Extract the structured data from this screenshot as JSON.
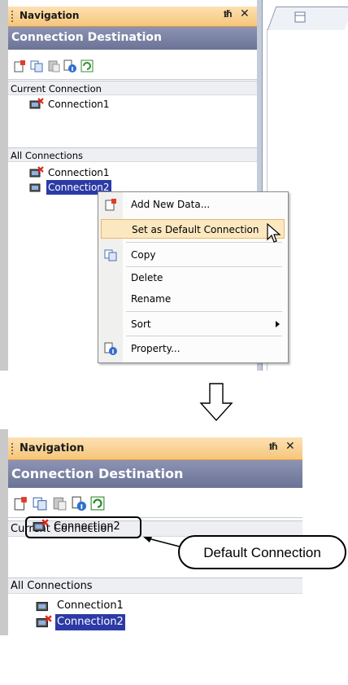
{
  "top_panel": {
    "nav_title": "Navigation",
    "pin": "X",
    "dest_title": "Connection Destination",
    "current_label": "Current Connection",
    "current_connection": "Connection1",
    "all_label": "All Connections",
    "all_connections": [
      "Connection1",
      "Connection2"
    ]
  },
  "context_menu": {
    "items": [
      {
        "label": "Add New Data..."
      },
      {
        "label": "Set as Default Connection"
      },
      {
        "label": "Copy"
      },
      {
        "label": "Delete"
      },
      {
        "label": "Rename"
      },
      {
        "label": "Sort"
      },
      {
        "label": "Property..."
      }
    ]
  },
  "bottom_panel": {
    "nav_title": "Navigation",
    "dest_title": "Connection Destination",
    "current_label": "Current Connection",
    "current_connection": "Connection2",
    "all_label": "All Connections",
    "all_connections": [
      "Connection1",
      "Connection2"
    ]
  },
  "callout": {
    "text": "Default Connection"
  },
  "colors": {
    "header_orange": "#f6c57a",
    "dest_bar": "#7a82a6",
    "selection_blue": "#2c3aa6",
    "menu_highlight": "#fbe8c0"
  }
}
